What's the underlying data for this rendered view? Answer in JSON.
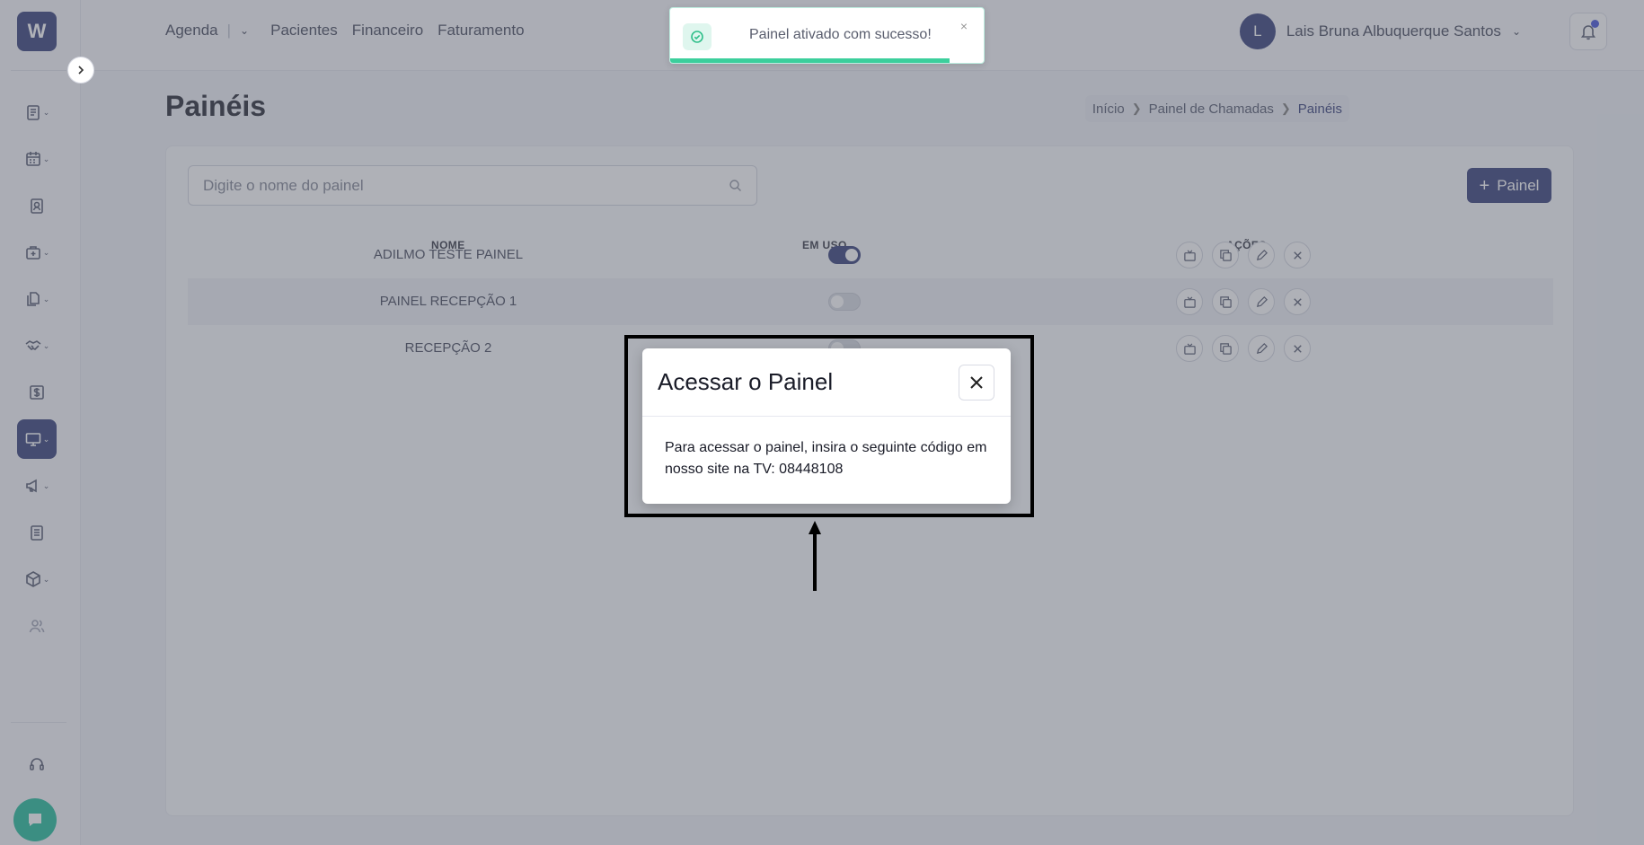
{
  "brand": {
    "logo_text": "W"
  },
  "topnav": {
    "agenda": "Agenda",
    "pacientes": "Pacientes",
    "financeiro": "Financeiro",
    "faturamento": "Faturamento"
  },
  "user": {
    "initial": "L",
    "name": "Lais Bruna Albuquerque Santos"
  },
  "page": {
    "title": "Painéis"
  },
  "breadcrumb": {
    "inicio": "Início",
    "painel_chamadas": "Painel de Chamadas",
    "paineis": "Painéis"
  },
  "search": {
    "placeholder": "Digite o nome do painel",
    "value": ""
  },
  "add_button": {
    "label": "Painel"
  },
  "table": {
    "headers": {
      "nome": "NOME",
      "em_uso": "EM USO",
      "acoes": "AÇÕES"
    },
    "rows": [
      {
        "nome": "ADILMO TESTE PAINEL",
        "em_uso": true
      },
      {
        "nome": "PAINEL RECEPÇÃO 1",
        "em_uso": false
      },
      {
        "nome": "RECEPÇÃO 2",
        "em_uso": false
      }
    ]
  },
  "toast": {
    "message": "Painel ativado com sucesso!",
    "close": "×",
    "progress": 0.89
  },
  "modal": {
    "title": "Acessar o Painel",
    "body": "Para acessar o painel, insira o seguinte código em nosso site na TV: 08448108"
  },
  "colors": {
    "primary": "#2b3572",
    "success": "#3ccf9c",
    "chat": "#17b895"
  }
}
